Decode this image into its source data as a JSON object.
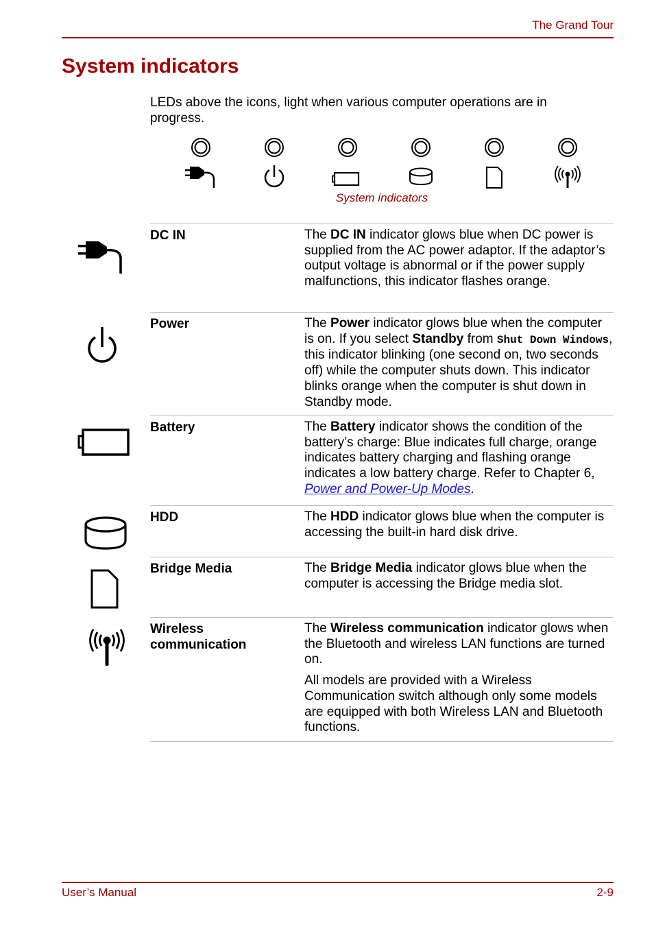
{
  "header": {
    "section": "The Grand Tour"
  },
  "page_title": "System indicators",
  "intro": "LEDs above the icons, light when various computer operations are in progress.",
  "figure": {
    "caption": "System indicators",
    "leds": [
      {
        "icon": "dc-in-plug-icon"
      },
      {
        "icon": "power-icon"
      },
      {
        "icon": "battery-icon"
      },
      {
        "icon": "hdd-icon"
      },
      {
        "icon": "bridge-media-icon"
      },
      {
        "icon": "wireless-icon"
      }
    ]
  },
  "indicators": [
    {
      "icon": "dc-in-plug-icon",
      "label": "DC IN",
      "desc": {
        "pre": "The ",
        "bold": "DC IN",
        "post": " indicator glows blue when DC power is supplied from the AC power adaptor. If the adaptor’s output voltage is abnormal or if the power supply malfunctions, this indicator flashes orange."
      }
    },
    {
      "icon": "power-icon",
      "label": "Power",
      "desc": {
        "pre": "The ",
        "bold": "Power",
        "mid1": " indicator glows blue when the computer is on. If you select ",
        "bold2": "Standby",
        "mid2": " from ",
        "code": "Shut Down Windows",
        "post": ", this indicator blinking (one second on, two seconds off) while the computer shuts down. This indicator blinks orange when the computer is shut down in Standby mode."
      }
    },
    {
      "icon": "battery-icon",
      "label": "Battery",
      "desc": {
        "pre": "The ",
        "bold": "Battery",
        "mid1": " indicator shows the condition of the battery’s charge: Blue indicates full charge, orange indicates battery charging and flashing orange indicates a low battery charge. Refer to Chapter 6, ",
        "link": "Power and Power-Up Modes",
        "post": "."
      }
    },
    {
      "icon": "hdd-icon",
      "label": "HDD",
      "desc": {
        "pre": "The ",
        "bold": "HDD",
        "post": " indicator glows blue when the computer is accessing the built-in hard disk drive."
      }
    },
    {
      "icon": "bridge-media-icon",
      "label": "Bridge Media",
      "desc": {
        "pre": "The ",
        "bold": "Bridge Media",
        "post": " indicator glows blue when the computer is accessing the Bridge media slot."
      }
    },
    {
      "icon": "wireless-icon",
      "label": "Wireless communication",
      "desc": {
        "pre": "The ",
        "bold": "Wireless communication",
        "post": " indicator glows when the Bluetooth and wireless LAN functions are turned on."
      },
      "note": "All models are provided with a Wireless Communication switch although only some models are equipped with both Wireless LAN and Bluetooth functions."
    }
  ],
  "footer": {
    "left": "User’s Manual",
    "right": "2-9"
  },
  "colors": {
    "accent": "#a00000",
    "link": "#1a1acc",
    "rule": "#bdbdbd"
  }
}
